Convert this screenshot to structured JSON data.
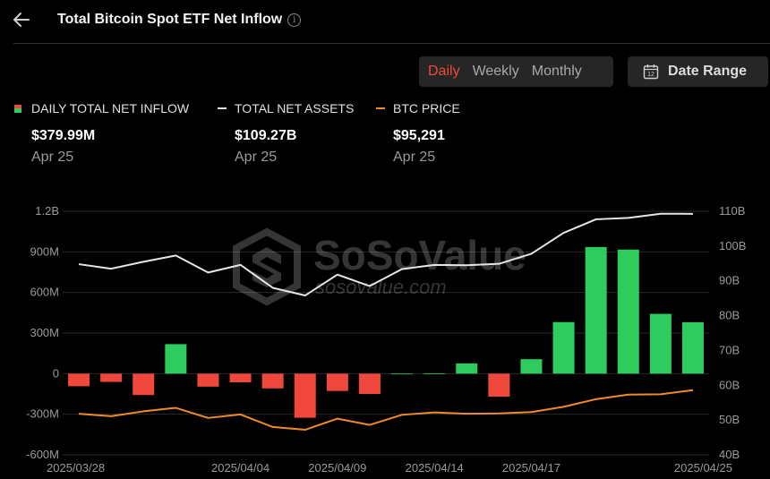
{
  "header": {
    "title": "Total Bitcoin Spot ETF Net Inflow",
    "info_glyph": "i"
  },
  "toolbar": {
    "periods": [
      {
        "label": "Daily",
        "active": true
      },
      {
        "label": "Weekly",
        "active": false
      },
      {
        "label": "Monthly",
        "active": false
      }
    ],
    "date_range_label": "Date Range",
    "calendar_day": "12"
  },
  "legend": [
    {
      "label": "DAILY TOTAL NET INFLOW",
      "value": "$379.99M",
      "date": "Apr 25",
      "icon": "bicolor-square"
    },
    {
      "label": "TOTAL NET ASSETS",
      "value": "$109.27B",
      "date": "Apr 25",
      "icon": "line",
      "color": "#e6e6e6"
    },
    {
      "label": "BTC PRICE",
      "value": "$95,291",
      "date": "Apr 25",
      "icon": "line",
      "color": "#f08a2a"
    }
  ],
  "watermark": {
    "brand": "SoSoValue",
    "url": "sosovalue.com"
  },
  "colors": {
    "inflow_positive": "#2ecc5e",
    "inflow_negative": "#f0473c",
    "assets_line": "#e6e6e6",
    "price_line": "#f08a2a",
    "grid": "#2a2a2a",
    "active_period": "#f2483a"
  },
  "chart_data": {
    "type": "bar",
    "x": [
      "2025/03/28",
      "2025/03/31",
      "2025/04/01",
      "2025/04/02",
      "2025/04/03",
      "2025/04/04",
      "2025/04/07",
      "2025/04/08",
      "2025/04/09",
      "2025/04/10",
      "2025/04/11",
      "2025/04/14",
      "2025/04/15",
      "2025/04/16",
      "2025/04/17",
      "2025/04/21",
      "2025/04/22",
      "2025/04/23",
      "2025/04/24",
      "2025/04/25"
    ],
    "x_tick_labels": [
      "2025/03/28",
      "2025/04/04",
      "2025/04/09",
      "2025/04/14",
      "2025/04/17",
      "2025/04/25"
    ],
    "x_tick_indices": [
      0,
      5,
      8,
      11,
      14,
      19
    ],
    "series": [
      {
        "name": "DAILY TOTAL NET INFLOW",
        "type": "bar",
        "axis": "left",
        "values": [
          -93,
          -61,
          -158,
          218,
          -96,
          -64,
          -109,
          -326,
          -128,
          -150,
          0,
          1,
          76,
          -170,
          107,
          381,
          936,
          917,
          442,
          380
        ]
      },
      {
        "name": "TOTAL NET ASSETS",
        "type": "line",
        "axis": "right",
        "values": [
          94.8,
          93.5,
          95.5,
          97.3,
          92.4,
          94.6,
          88.0,
          85.8,
          91.8,
          88.5,
          93.4,
          94.6,
          94.5,
          94.9,
          97.8,
          103.8,
          107.7,
          108.1,
          109.3,
          109.27
        ]
      },
      {
        "name": "BTC PRICE",
        "type": "line",
        "axis": "right",
        "values": [
          51.8,
          51.1,
          52.5,
          53.5,
          50.6,
          51.6,
          48.0,
          47.2,
          50.4,
          48.6,
          51.5,
          52.2,
          51.8,
          51.9,
          52.3,
          53.8,
          56.0,
          57.3,
          57.4,
          58.6
        ]
      }
    ],
    "y_left": {
      "ticks": [
        -600,
        -300,
        0,
        300,
        600,
        900,
        1200
      ],
      "tick_labels": [
        "-600M",
        "-300M",
        "0",
        "300M",
        "600M",
        "900M",
        "1.2B"
      ],
      "range": [
        -600,
        1200
      ]
    },
    "y_right": {
      "ticks": [
        40,
        50,
        60,
        70,
        80,
        90,
        100,
        110
      ],
      "tick_labels": [
        "40B",
        "50B",
        "60B",
        "70B",
        "80B",
        "90B",
        "100B",
        "110B"
      ],
      "range": [
        40,
        110
      ]
    },
    "grid": true,
    "legend_position": "top-left"
  }
}
